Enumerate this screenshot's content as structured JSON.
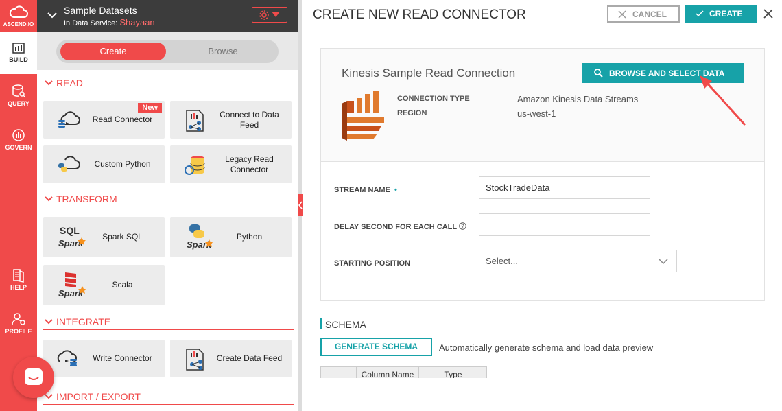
{
  "app": {
    "logo_label": "ASCEND.IO",
    "nav": [
      {
        "label": "BUILD",
        "icon": "build-icon",
        "active": true
      },
      {
        "label": "QUERY",
        "icon": "query-icon"
      },
      {
        "label": "GOVERN",
        "icon": "govern-icon"
      },
      {
        "label": "HELP",
        "icon": "help-icon"
      },
      {
        "label": "PROFILE",
        "icon": "profile-icon"
      }
    ],
    "accent": "#f04a4a",
    "teal": "#17a2a8"
  },
  "panel": {
    "title": "Sample Datasets",
    "subtitle_prefix": "In Data Service: ",
    "service_name": "Shayaan",
    "toggle": {
      "create": "Create",
      "browse": "Browse"
    },
    "sections": {
      "read": "READ",
      "transform": "TRANSFORM",
      "integrate": "INTEGRATE",
      "import_export": "IMPORT / EXPORT"
    },
    "cards": {
      "read_connector": "Read Connector",
      "new_badge": "New",
      "connect_feed": "Connect to Data Feed",
      "custom_python": "Custom Python",
      "legacy_read": "Legacy Read Connector",
      "spark_sql": "Spark SQL",
      "python": "Python",
      "scala": "Scala",
      "write_connector": "Write Connector",
      "create_feed": "Create Data Feed"
    }
  },
  "main": {
    "title": "CREATE NEW READ CONNECTOR",
    "cancel": "CANCEL",
    "create": "CREATE",
    "connection_name": "Kinesis Sample Read Connection",
    "browse_button": "BROWSE AND SELECT DATA",
    "connection_type_label": "CONNECTION TYPE",
    "connection_type_value": "Amazon Kinesis Data Streams",
    "region_label": "REGION",
    "region_value": "us-west-1",
    "stream_name_label": "STREAM NAME",
    "stream_name_value": "StockTradeData",
    "delay_label": "DELAY SECOND FOR EACH CALL",
    "delay_value": "",
    "starting_position_label": "STARTING POSITION",
    "starting_position_placeholder": "Select...",
    "schema_title": "SCHEMA",
    "generate_schema": "GENERATE SCHEMA",
    "generate_desc": "Automatically generate schema and load data preview",
    "columns": [
      "Column Name",
      "Type"
    ]
  }
}
